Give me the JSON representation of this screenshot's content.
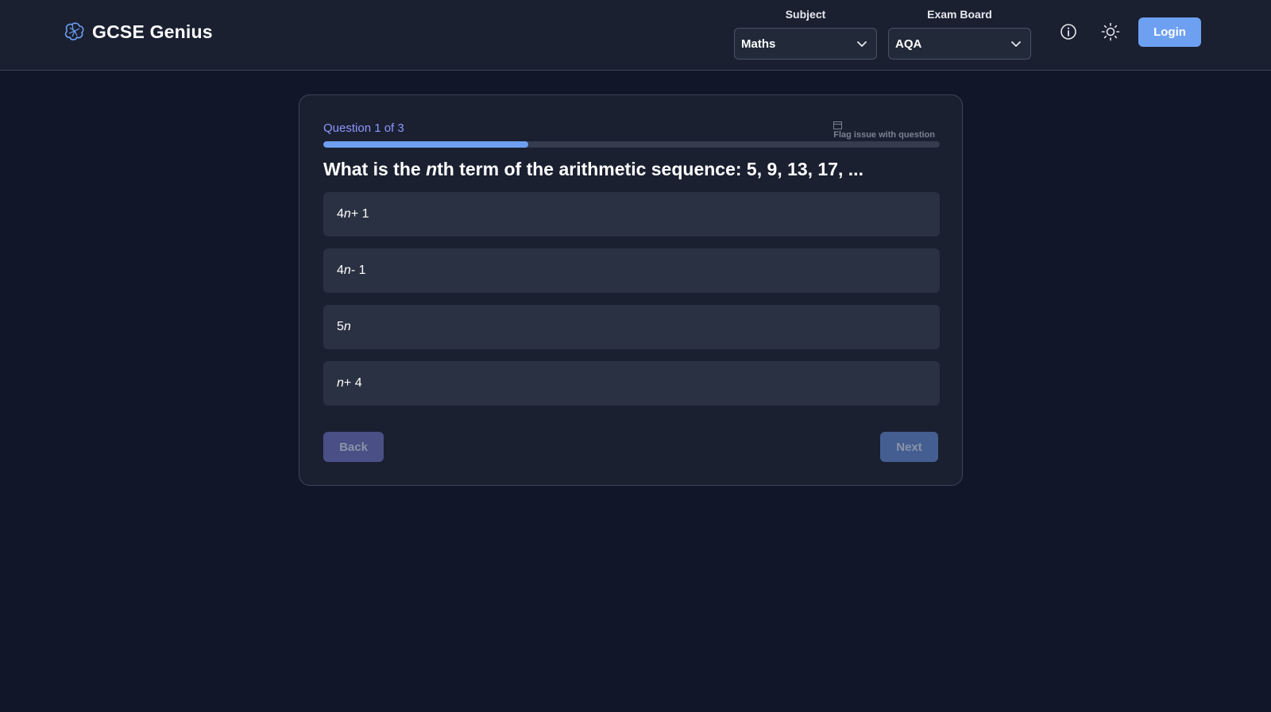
{
  "header": {
    "brand_name": "GCSE Genius",
    "subject": {
      "label": "Subject",
      "value": "Maths"
    },
    "exam_board": {
      "label": "Exam Board",
      "value": "AQA"
    },
    "login_label": "Login"
  },
  "quiz": {
    "question_counter": "Question 1 of 3",
    "progress_fraction": 0.333,
    "flag_label": "Flag issue with question",
    "question_prefix": "What is the ",
    "question_var": "n",
    "question_suffix": "th term of the arithmetic sequence: 5, 9, 13, 17, ...",
    "options": [
      {
        "pre": "4",
        "var": "n",
        "post": " + 1"
      },
      {
        "pre": "4",
        "var": "n",
        "post": " - 1"
      },
      {
        "pre": "5",
        "var": "n",
        "post": ""
      },
      {
        "pre": "",
        "var": "n",
        "post": " + 4"
      }
    ],
    "back_label": "Back",
    "next_label": "Next"
  },
  "colors": {
    "accent": "#6ea0f2",
    "counter": "#8f96ff",
    "background": "#111729"
  },
  "icons": {
    "logo": "brain-icon",
    "info": "info-icon",
    "theme": "sun-icon",
    "flag": "flag-icon",
    "dropdown": "chevron-down-icon"
  }
}
